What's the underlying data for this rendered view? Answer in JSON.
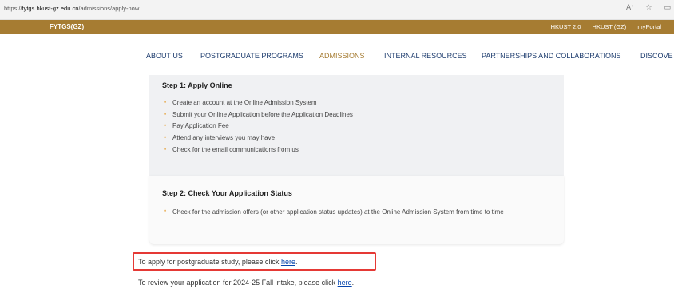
{
  "browser": {
    "url_prefix": "https://",
    "url_host": "fytgs.hkust-gz.edu.cn",
    "url_path": "/admissions/apply-now"
  },
  "topbar": {
    "site_name": "FYTGS(GZ)",
    "links": [
      "HKUST 2.0",
      "HKUST (GZ)",
      "myPortal"
    ]
  },
  "nav": {
    "items": [
      "ABOUT US",
      "POSTGRADUATE PROGRAMS",
      "ADMISSIONS",
      "INTERNAL RESOURCES",
      "PARTNERSHIPS AND COLLABORATIONS",
      "DISCOVE"
    ],
    "active": "ADMISSIONS"
  },
  "step1": {
    "title": "Step 1: Apply Online",
    "items": [
      "Create an account at the Online Admission System",
      "Submit your Online Application before the Application Deadlines",
      "Pay Application Fee",
      "Attend any interviews you may have",
      "Check for the email communications from us"
    ]
  },
  "step2": {
    "title": "Step 2: Check Your Application Status",
    "items": [
      "Check for the admission offers (or other application status updates) at the Online Admission System from time to time"
    ]
  },
  "apply": {
    "text": "To apply for postgraduate study, please click ",
    "link": "here",
    "suffix": "."
  },
  "review": {
    "text": "To review your application for 2024-25 Fall intake, please click ",
    "link": "here",
    "suffix": "."
  },
  "colors": {
    "brand_gold": "#a67c32",
    "nav_blue": "#1d3c6e",
    "bullet": "#e6a23c",
    "highlight_border": "#e53935"
  }
}
